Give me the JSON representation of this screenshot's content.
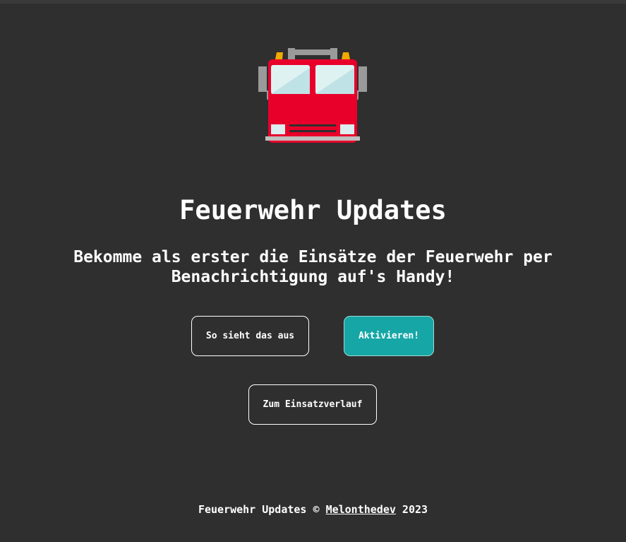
{
  "app": {
    "logo_icon": "fire-truck-icon",
    "title": "Feuerwehr Updates",
    "subtitle": "Bekomme als erster die Einsätze der Feuerwehr per Benachrichtigung auf's Handy!"
  },
  "buttons": {
    "demo_label": "So sieht das aus",
    "activate_label": "Aktivieren!",
    "history_label": "Zum Einsatzverlauf"
  },
  "footer": {
    "prefix": "Feuerwehr Updates © ",
    "author_link": "Melonthedev",
    "suffix": " 2023"
  },
  "colors": {
    "background": "#2f2f2f",
    "accent": "#16a6a6",
    "truck_red": "#e8002a"
  }
}
